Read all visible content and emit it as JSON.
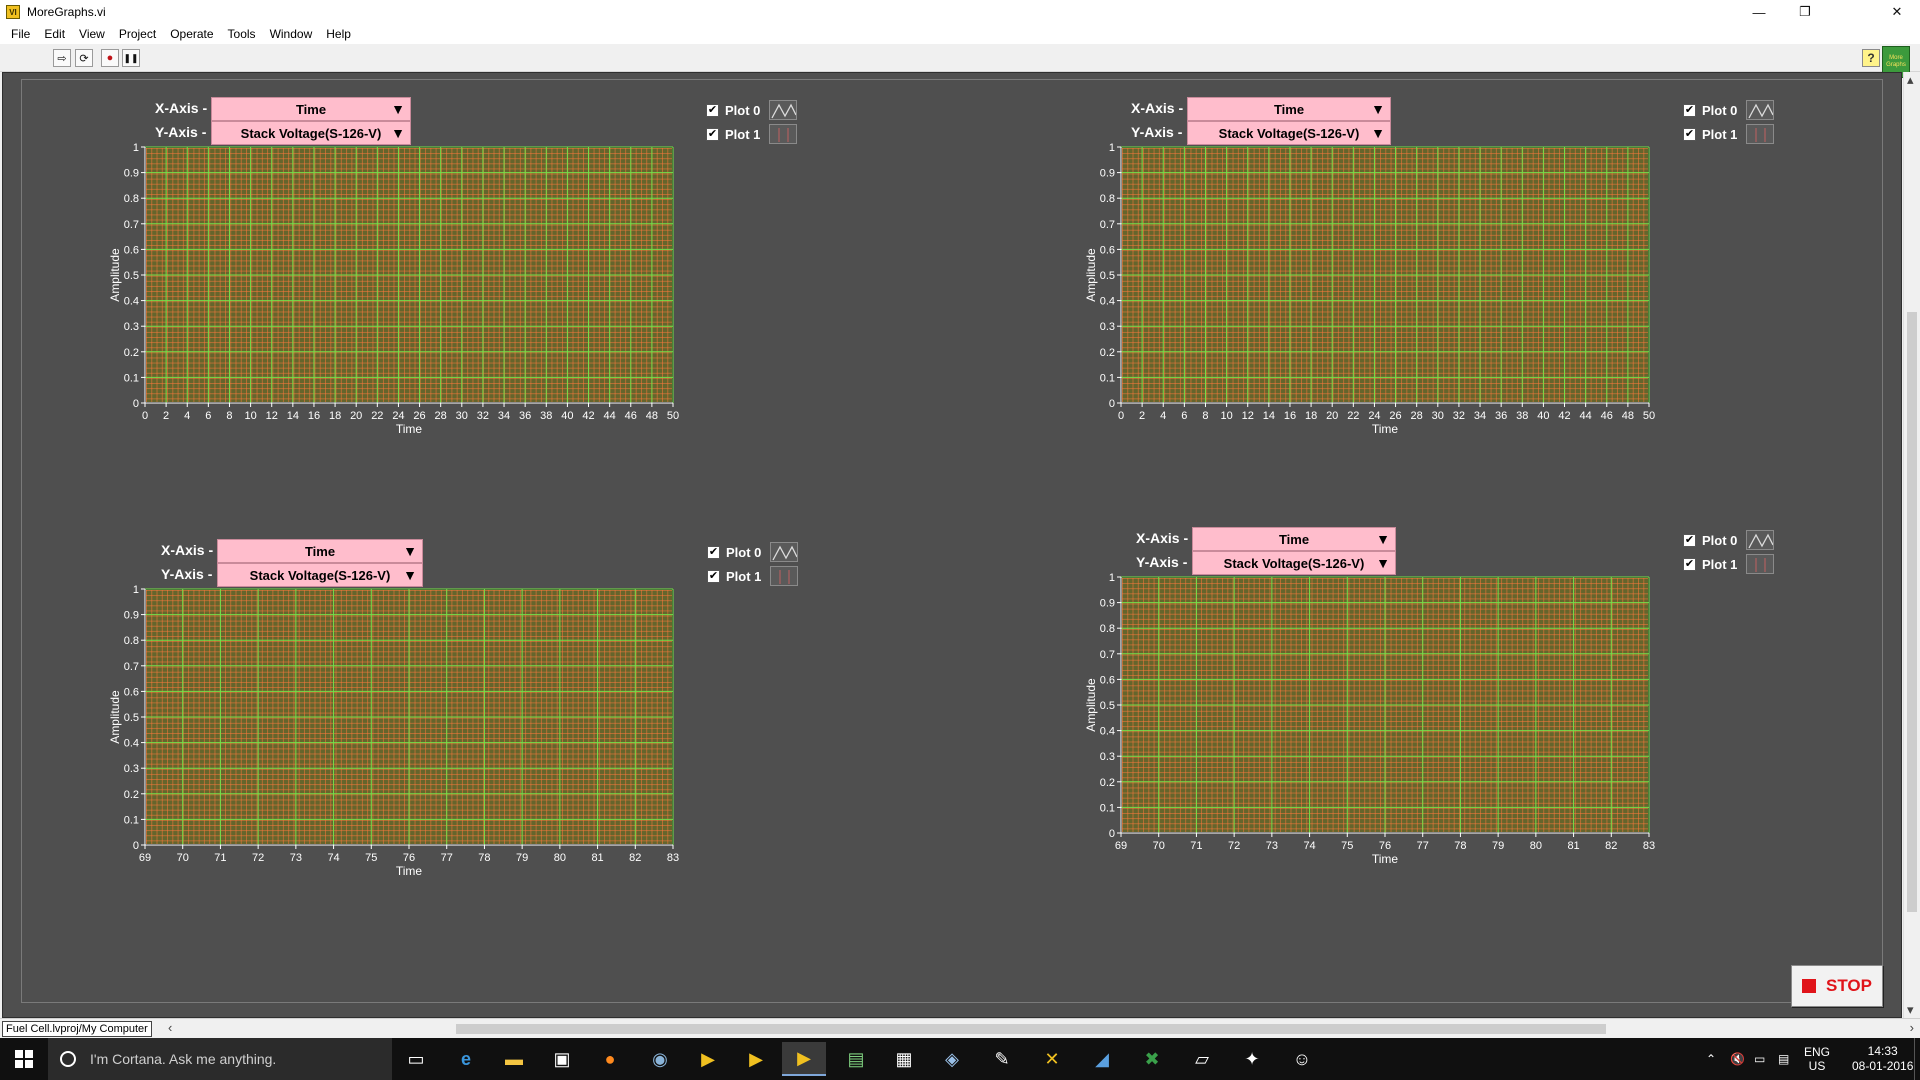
{
  "window": {
    "title": "MoreGraphs.vi",
    "icon_label": "VI",
    "controls": {
      "minimize": "—",
      "restore": "❐",
      "close": "✕"
    }
  },
  "menu": [
    "File",
    "Edit",
    "View",
    "Project",
    "Operate",
    "Tools",
    "Window",
    "Help"
  ],
  "toolbar": {
    "run_glyph": "⇨",
    "run_continuous_glyph": "⟳",
    "abort_glyph": "●",
    "pause_glyph": "❚❚",
    "help_glyph": "?",
    "vi_icon_text": "More Graphs"
  },
  "graphs": [
    {
      "x_axis_label": "X-Axis -",
      "x_axis_value": "Time",
      "y_axis_label": "Y-Axis -",
      "y_axis_value": "Stack Voltage(S-126-V)",
      "legend": [
        {
          "label": "Plot 0",
          "checked": "✔"
        },
        {
          "label": "Plot 1",
          "checked": "✔"
        }
      ]
    },
    {
      "x_axis_label": "X-Axis -",
      "x_axis_value": "Time",
      "y_axis_label": "Y-Axis -",
      "y_axis_value": "Stack Voltage(S-126-V)",
      "legend": [
        {
          "label": "Plot 0",
          "checked": "✔"
        },
        {
          "label": "Plot 1",
          "checked": "✔"
        }
      ]
    },
    {
      "x_axis_label": "X-Axis -",
      "x_axis_value": "Time",
      "y_axis_label": "Y-Axis -",
      "y_axis_value": "Stack Voltage(S-126-V)",
      "legend": [
        {
          "label": "Plot 0",
          "checked": "✔"
        },
        {
          "label": "Plot 1",
          "checked": "✔"
        }
      ]
    },
    {
      "x_axis_label": "X-Axis -",
      "x_axis_value": "Time",
      "y_axis_label": "Y-Axis -",
      "y_axis_value": "Stack Voltage(S-126-V)",
      "legend": [
        {
          "label": "Plot 0",
          "checked": "✔"
        },
        {
          "label": "Plot 1",
          "checked": "✔"
        }
      ]
    }
  ],
  "chart_data": [
    {
      "type": "line",
      "xlabel": "Time",
      "ylabel": "Amplitude",
      "xlim": [
        0,
        50
      ],
      "ylim": [
        0,
        1
      ],
      "x_ticks": [
        "0",
        "2",
        "4",
        "6",
        "8",
        "10",
        "12",
        "14",
        "16",
        "18",
        "20",
        "22",
        "24",
        "26",
        "28",
        "30",
        "32",
        "34",
        "36",
        "38",
        "40",
        "42",
        "44",
        "46",
        "48",
        "50"
      ],
      "y_ticks": [
        "0",
        "0.1",
        "0.2",
        "0.3",
        "0.4",
        "0.5",
        "0.6",
        "0.7",
        "0.8",
        "0.9",
        "1"
      ],
      "grid": true,
      "series": []
    },
    {
      "type": "line",
      "xlabel": "Time",
      "ylabel": "Amplitude",
      "xlim": [
        0,
        50
      ],
      "ylim": [
        0,
        1
      ],
      "x_ticks": [
        "0",
        "2",
        "4",
        "6",
        "8",
        "10",
        "12",
        "14",
        "16",
        "18",
        "20",
        "22",
        "24",
        "26",
        "28",
        "30",
        "32",
        "34",
        "36",
        "38",
        "40",
        "42",
        "44",
        "46",
        "48",
        "50"
      ],
      "y_ticks": [
        "0",
        "0.1",
        "0.2",
        "0.3",
        "0.4",
        "0.5",
        "0.6",
        "0.7",
        "0.8",
        "0.9",
        "1"
      ],
      "grid": true,
      "series": []
    },
    {
      "type": "line",
      "xlabel": "Time",
      "ylabel": "Amplitude",
      "xlim": [
        69,
        83
      ],
      "ylim": [
        0,
        1
      ],
      "x_ticks": [
        "69",
        "70",
        "71",
        "72",
        "73",
        "74",
        "75",
        "76",
        "77",
        "78",
        "79",
        "80",
        "81",
        "82",
        "83"
      ],
      "y_ticks": [
        "0",
        "0.1",
        "0.2",
        "0.3",
        "0.4",
        "0.5",
        "0.6",
        "0.7",
        "0.8",
        "0.9",
        "1"
      ],
      "grid": true,
      "series": []
    },
    {
      "type": "line",
      "xlabel": "Time",
      "ylabel": "Amplitude",
      "xlim": [
        69,
        83
      ],
      "ylim": [
        0,
        1
      ],
      "x_ticks": [
        "69",
        "70",
        "71",
        "72",
        "73",
        "74",
        "75",
        "76",
        "77",
        "78",
        "79",
        "80",
        "81",
        "82",
        "83"
      ],
      "y_ticks": [
        "0",
        "0.1",
        "0.2",
        "0.3",
        "0.4",
        "0.5",
        "0.6",
        "0.7",
        "0.8",
        "0.9",
        "1"
      ],
      "grid": true,
      "series": []
    }
  ],
  "stop_button": {
    "label": "STOP"
  },
  "statusbar": {
    "context": "Fuel Cell.lvproj/My Computer"
  },
  "taskbar": {
    "cortana_placeholder": "I'm Cortana. Ask me anything.",
    "language": "ENG",
    "region": "US",
    "time": "14:33",
    "date": "08-01-2016"
  }
}
